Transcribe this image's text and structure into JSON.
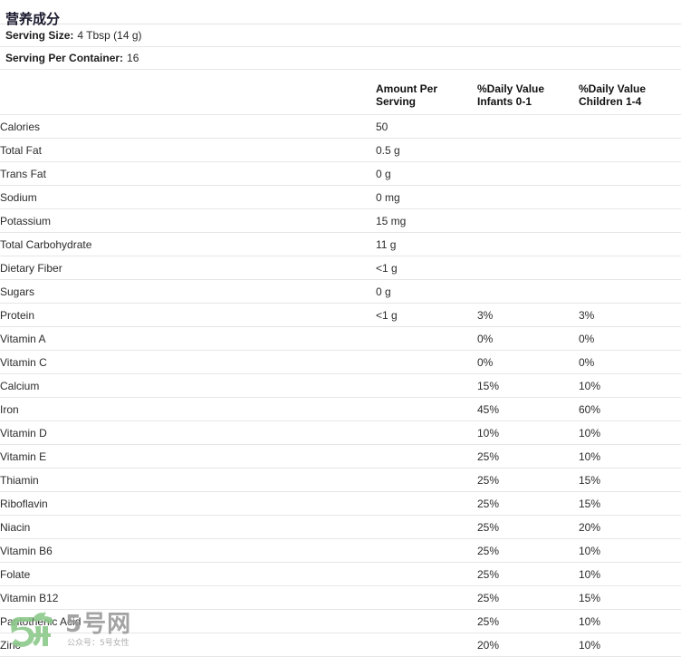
{
  "header": {
    "title": "营养成分"
  },
  "serving": {
    "size_label": "Serving Size:",
    "size_value": "4 Tbsp (14 g)",
    "container_label": "Serving Per Container:",
    "container_value": "16"
  },
  "columns": {
    "name": "",
    "amount_line1": "Amount Per",
    "amount_line2": "Serving",
    "infants_line1": "%Daily Value",
    "infants_line2": "Infants 0-1",
    "children_line1": "%Daily Value",
    "children_line2": "Children 1-4"
  },
  "rows": [
    {
      "name": "Calories",
      "amount": "50",
      "infants": "",
      "children": ""
    },
    {
      "name": "Total Fat",
      "amount": "0.5 g",
      "infants": "",
      "children": ""
    },
    {
      "name": "Trans Fat",
      "amount": "0 g",
      "infants": "",
      "children": ""
    },
    {
      "name": "Sodium",
      "amount": "0 mg",
      "infants": "",
      "children": ""
    },
    {
      "name": "Potassium",
      "amount": "15 mg",
      "infants": "",
      "children": ""
    },
    {
      "name": "Total Carbohydrate",
      "amount": "11 g",
      "infants": "",
      "children": ""
    },
    {
      "name": "Dietary Fiber",
      "amount": "<1 g",
      "infants": "",
      "children": ""
    },
    {
      "name": "Sugars",
      "amount": "0 g",
      "infants": "",
      "children": ""
    },
    {
      "name": "Protein",
      "amount": "<1 g",
      "infants": "3%",
      "children": "3%"
    },
    {
      "name": "Vitamin A",
      "amount": "",
      "infants": "0%",
      "children": "0%"
    },
    {
      "name": "Vitamin C",
      "amount": "",
      "infants": "0%",
      "children": "0%"
    },
    {
      "name": "Calcium",
      "amount": "",
      "infants": "15%",
      "children": "10%"
    },
    {
      "name": "Iron",
      "amount": "",
      "infants": "45%",
      "children": "60%"
    },
    {
      "name": "Vitamin D",
      "amount": "",
      "infants": "10%",
      "children": "10%"
    },
    {
      "name": "Vitamin E",
      "amount": "",
      "infants": "25%",
      "children": "10%"
    },
    {
      "name": "Thiamin",
      "amount": "",
      "infants": "25%",
      "children": "15%"
    },
    {
      "name": "Riboflavin",
      "amount": "",
      "infants": "25%",
      "children": "15%"
    },
    {
      "name": "Niacin",
      "amount": "",
      "infants": "25%",
      "children": "20%"
    },
    {
      "name": "Vitamin B6",
      "amount": "",
      "infants": "25%",
      "children": "10%"
    },
    {
      "name": "Folate",
      "amount": "",
      "infants": "25%",
      "children": "10%"
    },
    {
      "name": "Vitamin B12",
      "amount": "",
      "infants": "25%",
      "children": "15%"
    },
    {
      "name": "Pantothenic Acid",
      "amount": "",
      "infants": "25%",
      "children": "10%"
    },
    {
      "name": "Zinc",
      "amount": "",
      "infants": "20%",
      "children": "10%"
    }
  ],
  "watermark": {
    "brand": "5号网",
    "subtitle": "公众号：5号女性",
    "logo_color": "#8cc98a",
    "text_color": "#9a9a9a"
  }
}
